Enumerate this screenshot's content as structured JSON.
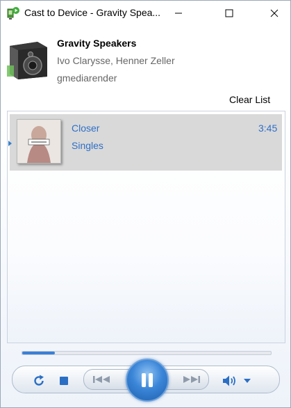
{
  "window": {
    "title": "Cast to Device - Gravity Spea..."
  },
  "device": {
    "name": "Gravity Speakers",
    "authors": "Ivo Clarysse, Henner Zeller",
    "renderer": "gmediarender"
  },
  "toolbar": {
    "clear_list_label": "Clear List"
  },
  "playlist": {
    "items": [
      {
        "title": "Closer",
        "album": "Singles",
        "duration": "3:45",
        "selected": true
      }
    ]
  },
  "playback": {
    "progress": 0.13,
    "state": "playing"
  },
  "icons": {
    "app": "cast-to-device-icon",
    "device": "speaker-icon",
    "repeat": "repeat-icon",
    "stop": "stop-icon",
    "previous": "previous-icon",
    "pause": "pause-icon",
    "next": "next-icon",
    "volume": "volume-icon"
  },
  "colors": {
    "accent": "#2e6fc7",
    "selection": "#d9d9d9",
    "play_button": "#3b86d8"
  }
}
